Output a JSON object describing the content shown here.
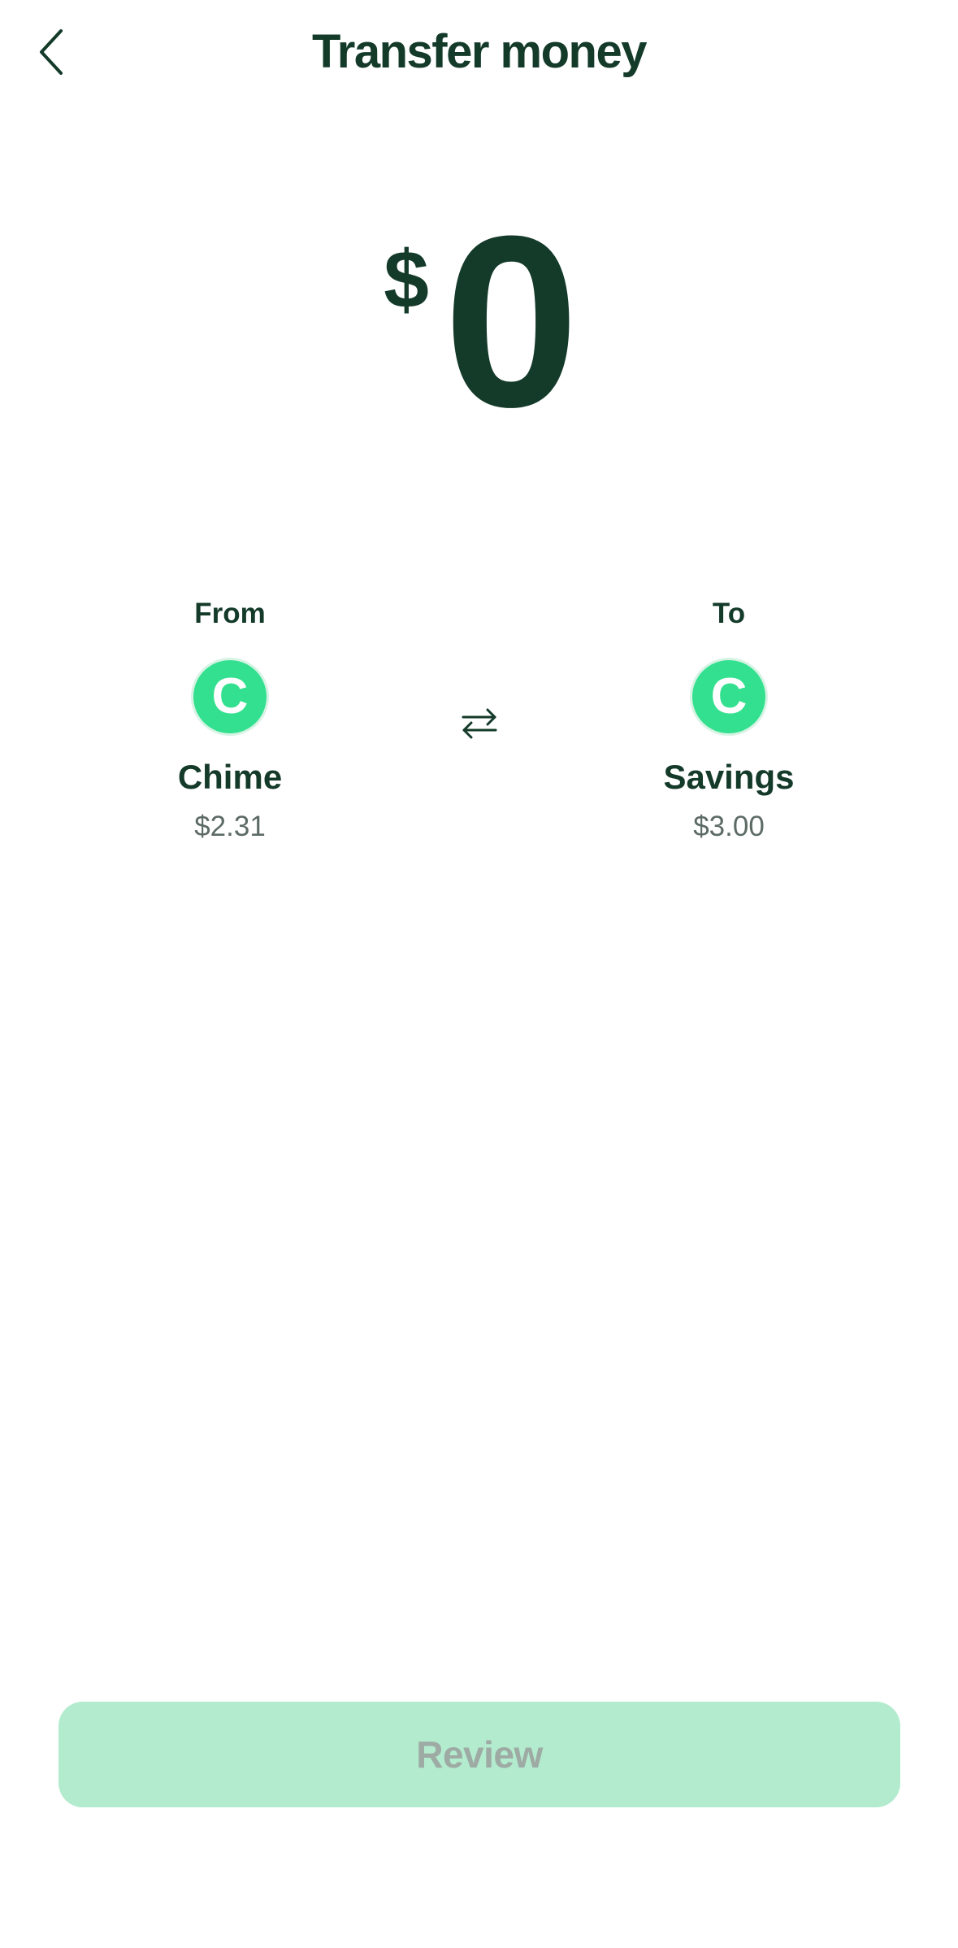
{
  "header": {
    "back_icon": "chevron-left-icon",
    "title": "Transfer money"
  },
  "amount": {
    "currency_symbol": "$",
    "value": "0"
  },
  "from_account": {
    "label": "From",
    "logo_letter": "C",
    "name": "Chime",
    "balance": "$2.31"
  },
  "to_account": {
    "label": "To",
    "logo_letter": "C",
    "name": "Savings",
    "balance": "$3.00"
  },
  "swap_icon": "swap-arrows-icon",
  "review_button": {
    "label": "Review"
  },
  "colors": {
    "primary_text": "#143a2a",
    "accent_green": "#33e08f",
    "disabled_button_bg": "#b3ebce",
    "disabled_button_text": "#9eaaa4",
    "secondary_text": "#5d6b65"
  }
}
